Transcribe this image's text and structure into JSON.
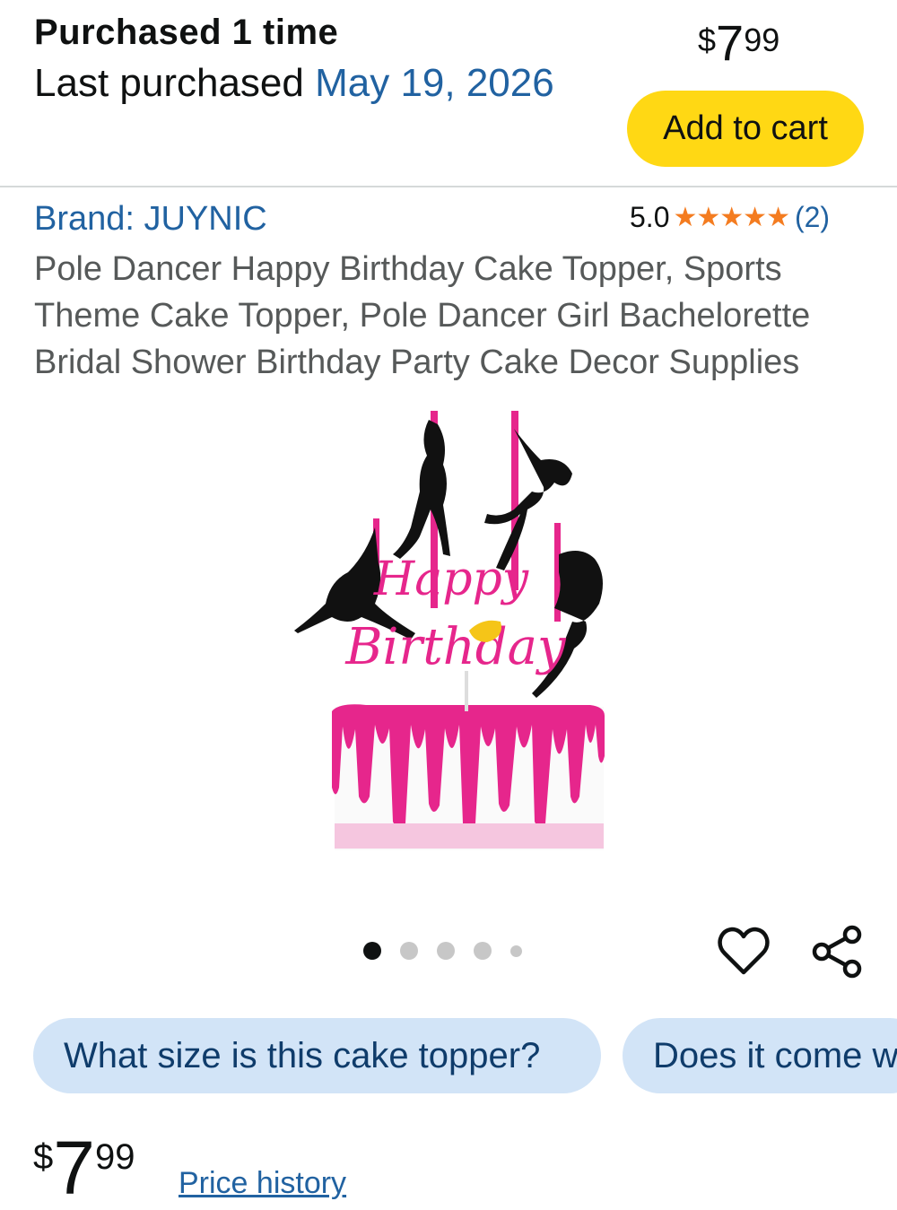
{
  "purchase": {
    "count_label": "Purchased 1 time",
    "last_prefix": "Last purchased ",
    "last_date": "May 19, 2026"
  },
  "top_price": {
    "currency": "$",
    "whole": "7",
    "fraction": "99"
  },
  "add_to_cart_label": "Add to cart",
  "product": {
    "brand": "Brand: JUYNIC",
    "rating": "5.0",
    "stars": "★★★★★",
    "rating_count": "(2)",
    "title": "Pole Dancer Happy Birthday Cake Topper, Sports Theme Cake Topper, Pole Dancer Girl Bachelorette Bridal Shower Birthday Party Cake Decor Supplies",
    "image_topper_text": [
      "Happy",
      "Birthday"
    ]
  },
  "carousel": {
    "count": 5,
    "active_index": 0
  },
  "questions": [
    "What size is this cake topper?",
    "Does it come w"
  ],
  "bottom_price": {
    "currency": "$",
    "whole": "7",
    "fraction": "99"
  },
  "price_history_label": "Price history",
  "colors": {
    "accent": "#ffd814",
    "link": "#2162a1",
    "star": "#f47c20",
    "chip": "#d2e4f7",
    "pink": "#e6268c"
  },
  "icons": [
    "heart-icon",
    "share-icon",
    "star-icon"
  ]
}
